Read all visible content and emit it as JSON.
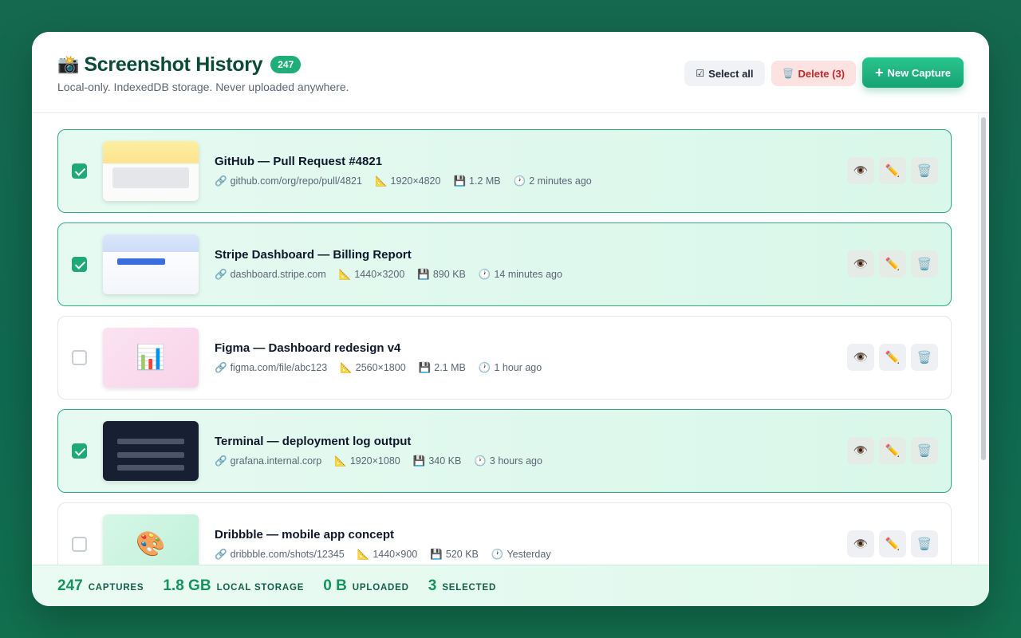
{
  "header": {
    "title_emoji": "📸",
    "title": "Screenshot History",
    "count_badge": "247",
    "subtitle": "Local-only. IndexedDB storage. Never uploaded anywhere."
  },
  "actions": {
    "select_all_icon": "☑",
    "select_all_label": "Select all",
    "delete_icon": "🗑️",
    "delete_label": "Delete (3)",
    "new_icon": "+",
    "new_label": "New Capture"
  },
  "row_action_icons": {
    "view": "👁️",
    "edit": "✏️",
    "delete": "🗑️"
  },
  "meta_icons": {
    "url": "🔗",
    "size": "📐",
    "file": "💾",
    "time": "🕐"
  },
  "rows": [
    {
      "title": "GitHub — Pull Request #4821",
      "url": "github.com/org/repo/pull/4821",
      "dims": "1920×4820",
      "size": "1.2 MB",
      "time": "2 minutes ago",
      "selected": true,
      "thumb": "github"
    },
    {
      "title": "Stripe Dashboard — Billing Report",
      "url": "dashboard.stripe.com",
      "dims": "1440×3200",
      "size": "890 KB",
      "time": "14 minutes ago",
      "selected": true,
      "thumb": "stripe"
    },
    {
      "title": "Figma — Dashboard redesign v4",
      "url": "figma.com/file/abc123",
      "dims": "2560×1800",
      "size": "2.1 MB",
      "time": "1 hour ago",
      "selected": false,
      "thumb": "figma",
      "thumb_icon": "📊"
    },
    {
      "title": "Terminal — deployment log output",
      "url": "grafana.internal.corp",
      "dims": "1920×1080",
      "size": "340 KB",
      "time": "3 hours ago",
      "selected": true,
      "thumb": "terminal"
    },
    {
      "title": "Dribbble — mobile app concept",
      "url": "dribbble.com/shots/12345",
      "dims": "1440×900",
      "size": "520 KB",
      "time": "Yesterday",
      "selected": false,
      "thumb": "dribbble",
      "thumb_icon": "🎨"
    }
  ],
  "footer": {
    "captures_value": "247",
    "captures_label": "CAPTURES",
    "storage_value": "1.8 GB",
    "storage_label": "LOCAL STORAGE",
    "uploaded_value": "0 B",
    "uploaded_label": "UPLOADED",
    "selected_value": "3",
    "selected_label": "SELECTED"
  },
  "colors": {
    "accent": "#1fae7a",
    "danger": "#c22b2b",
    "background": "#14694e"
  }
}
